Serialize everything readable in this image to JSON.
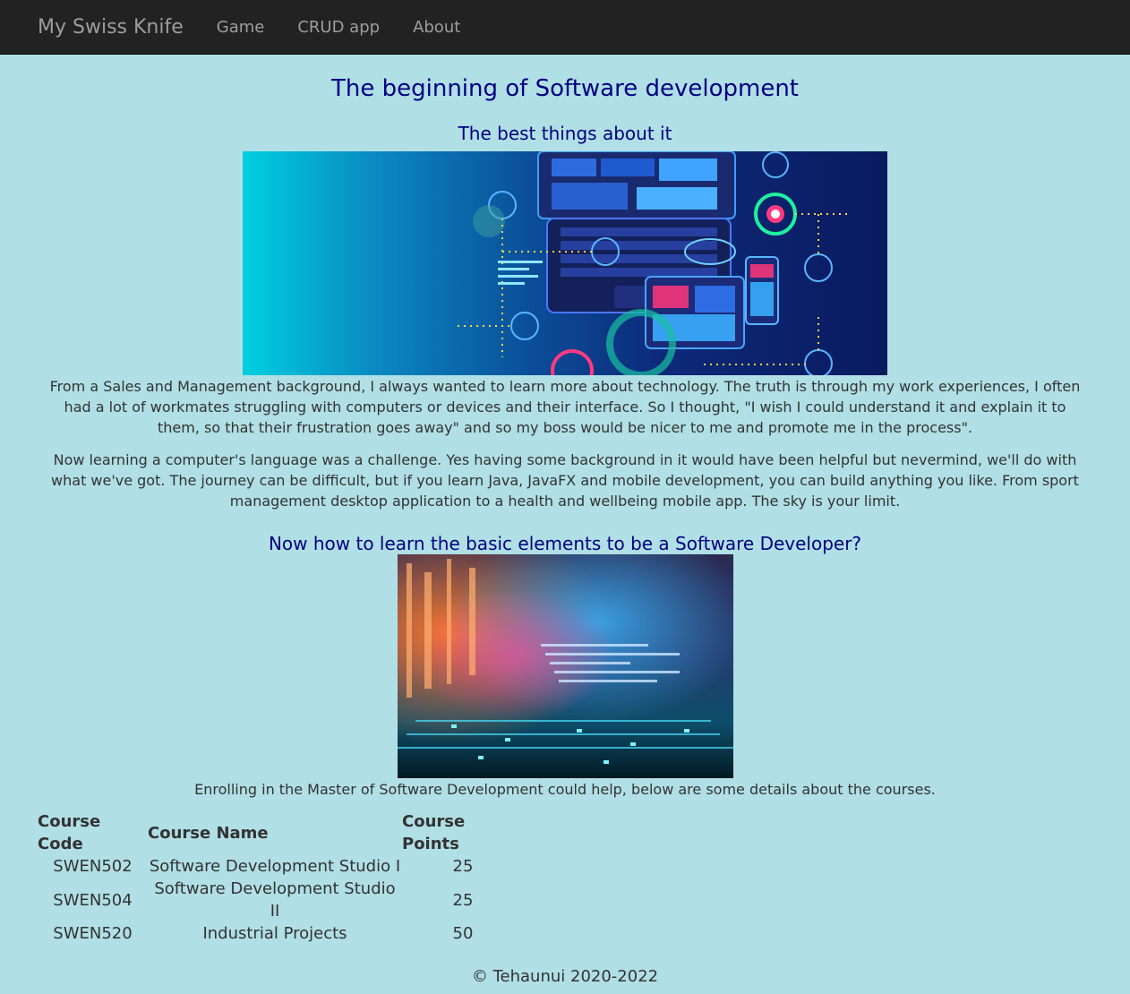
{
  "navbar": {
    "brand": "My Swiss Knife",
    "links": [
      "Game",
      "CRUD app",
      "About"
    ]
  },
  "main": {
    "title": "The beginning of Software development",
    "subtitle1": "The best things about it",
    "paragraph1": "From a Sales and Management background, I always wanted to learn more about technology. The truth is through my work experiences, I often had a lot of workmates struggling with computers or devices and their interface. So I thought, \"I wish I could understand it and explain it to them, so that their frustration goes away\" and so my boss would be nicer to me and promote me in the process\".",
    "paragraph2": "Now learning a computer's language was a challenge. Yes having some background in it would have been helpful but nevermind, we'll do with what we've got. The journey can be difficult, but if you learn Java, JavaFX and mobile development, you can build anything you like. From sport management desktop application to a health and wellbeing mobile app. The sky is your limit.",
    "subtitle2": "Now how to learn the basic elements to be a Software Developer?",
    "paragraph3": "Enrolling in the Master of Software Development could help, below are some details about the courses."
  },
  "table": {
    "headers": [
      "Course Code",
      "Course Name",
      "Course Points"
    ],
    "rows": [
      [
        "SWEN502",
        "Software Development Studio I",
        "25"
      ],
      [
        "SWEN504",
        "Software Development Studio II",
        "25"
      ],
      [
        "SWEN520",
        "Industrial Projects",
        "50"
      ]
    ]
  },
  "footer": {
    "text": "© Tehaunui 2020-2022"
  },
  "colors": {
    "background": "#b0dfe5",
    "navbar": "#222222",
    "heading": "#000080",
    "text": "#333333"
  }
}
